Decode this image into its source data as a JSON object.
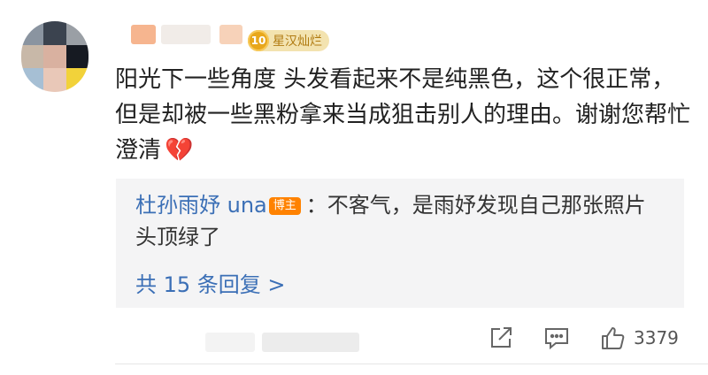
{
  "comment": {
    "level_badge": {
      "number": "10",
      "name": "星汉灿烂"
    },
    "text": "阳光下一些角度 头发看起来不是纯黑色，这个很正常，但是却被一些黑粉拿来当成狙击别人的理由。谢谢您帮忙澄清",
    "emoji": "💔"
  },
  "reply": {
    "author": "杜孙雨妤 una",
    "op_badge": "博主",
    "text": "：不客气，是雨妤发现自己那张照片头顶绿了",
    "more_link": "共 15 条回复 >"
  },
  "actions": {
    "like_count": "3379",
    "icons": [
      "share-icon",
      "comment-icon",
      "like-icon"
    ]
  },
  "colors": {
    "link_blue": "#3b6fb6",
    "op_badge_orange": "#ff8200",
    "level_gold": "#e8a71c",
    "heart_red": "#e2312b",
    "reply_bg": "#f4f4f5"
  }
}
